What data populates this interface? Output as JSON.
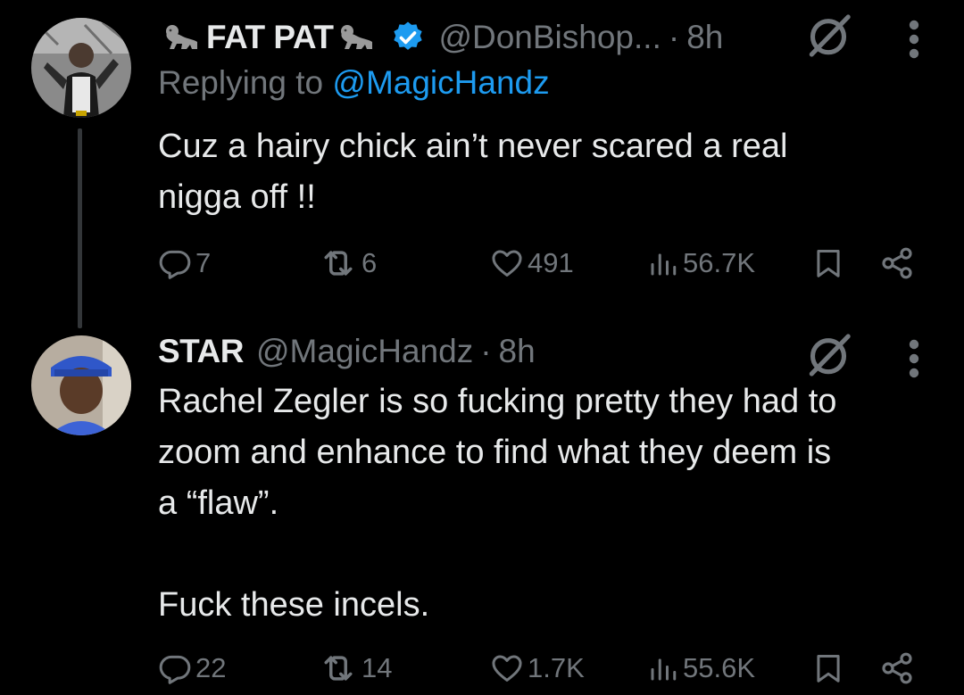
{
  "tweets": [
    {
      "display_name": "FAT PAT",
      "name_emoji": "gorilla-emoji",
      "verified": true,
      "handle": "@DonBishop...",
      "separator": "·",
      "time": "8h",
      "replying_prefix": "Replying to ",
      "replying_to": "@MagicHandz",
      "text": [
        "Cuz a hairy chick ain’t never scared a real",
        "nigga off !!"
      ],
      "replies": "7",
      "reposts": "6",
      "likes": "491",
      "views": "56.7K"
    },
    {
      "display_name": "STAR",
      "verified": false,
      "handle": "@MagicHandz",
      "separator": "·",
      "time": "8h",
      "text": [
        "Rachel Zegler is so fucking pretty they had to",
        "zoom and enhance to find what they deem is",
        "a “flaw”."
      ],
      "text2": "Fuck these incels.",
      "replies": "22",
      "reposts": "14",
      "likes": "1.7K",
      "views": "55.6K"
    }
  ],
  "colors": {
    "background": "#000000",
    "primary_text": "#e7e9ea",
    "secondary_text": "#71767b",
    "link": "#1d9bf0",
    "verified_badge": "#1d9bf0",
    "thread_line": "#333639"
  },
  "icons": [
    "grok-icon",
    "more-icon",
    "reply-icon",
    "repost-icon",
    "like-icon",
    "views-icon",
    "bookmark-icon",
    "share-icon",
    "verified-badge-icon"
  ]
}
